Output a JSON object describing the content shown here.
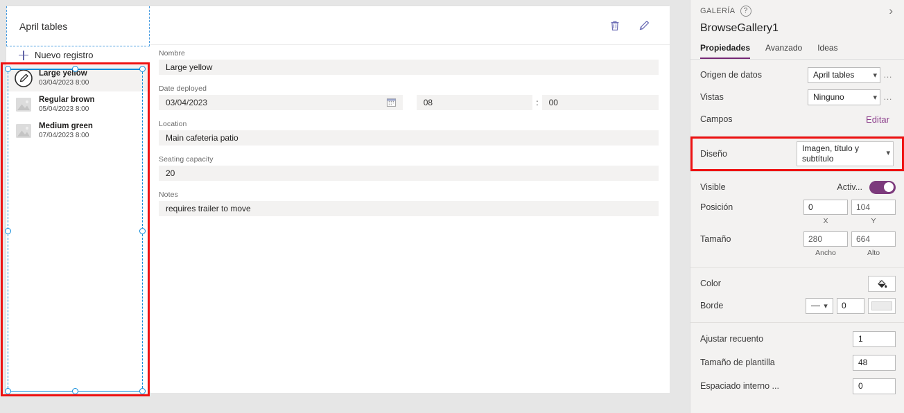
{
  "canvas": {
    "gallery": {
      "title": "April tables",
      "new_record_label": "Nuevo registro",
      "records": [
        {
          "title": "Large yellow",
          "subtitle": "03/04/2023 8:00",
          "thumb": "pencil-circle-icon",
          "selected": true
        },
        {
          "title": "Regular brown",
          "subtitle": "05/04/2023 8:00",
          "thumb": "image-placeholder-icon",
          "selected": false
        },
        {
          "title": "Medium green",
          "subtitle": "07/04/2023 8:00",
          "thumb": "image-placeholder-icon",
          "selected": false
        }
      ]
    },
    "form": {
      "toolbar": {
        "delete_icon": "trash-icon",
        "edit_icon": "pencil-icon"
      },
      "fields": [
        {
          "label": "Nombre",
          "value": "Large yellow"
        },
        {
          "label": "Location",
          "value": "Main cafeteria patio"
        },
        {
          "label": "Seating capacity",
          "value": "20"
        },
        {
          "label": "Notes",
          "value": "requires trailer to move"
        }
      ],
      "date_field": {
        "label": "Date deployed",
        "date": "03/04/2023",
        "calendar_icon": "calendar-icon",
        "hours": "08",
        "separator": ":",
        "minutes": "00"
      }
    }
  },
  "panel": {
    "kicker": "GALERÍA",
    "help_icon": "question-mark-icon",
    "collapse_icon": "chevron-right-icon",
    "object_name": "BrowseGallery1",
    "tabs": [
      {
        "label": "Propiedades",
        "active": true
      },
      {
        "label": "Avanzado",
        "active": false
      },
      {
        "label": "Ideas",
        "active": false
      }
    ],
    "data_source": {
      "label": "Origen de datos",
      "value": "April tables"
    },
    "views": {
      "label": "Vistas",
      "value": "Ninguno"
    },
    "fields": {
      "label": "Campos",
      "action": "Editar"
    },
    "layout": {
      "label": "Diseño",
      "value": "Imagen, título y subtítulo",
      "highlighted": true
    },
    "visible": {
      "label": "Visible",
      "state": "Activ...",
      "on": true
    },
    "position": {
      "label": "Posición",
      "x": "0",
      "y": "104",
      "x_caption": "X",
      "y_caption": "Y"
    },
    "size": {
      "label": "Tamaño",
      "w": "280",
      "h": "664",
      "w_caption": "Ancho",
      "h_caption": "Alto"
    },
    "color": {
      "label": "Color",
      "icon": "paint-bucket-icon"
    },
    "border": {
      "label": "Borde",
      "style": "solid-line",
      "width": "0",
      "color_swatch": "light-gray"
    },
    "tail_rows": [
      {
        "label": "Ajustar recuento",
        "value": "1"
      },
      {
        "label": "Tamaño de plantilla",
        "value": "48"
      },
      {
        "label": "Espaciado interno ...",
        "value": "0"
      }
    ],
    "colors": {
      "accent": "#742774",
      "link": "#8c3f8c",
      "toggle_on": "#7c3a7c",
      "highlight": "#ee1111",
      "selection": "#0f8cdb"
    }
  }
}
